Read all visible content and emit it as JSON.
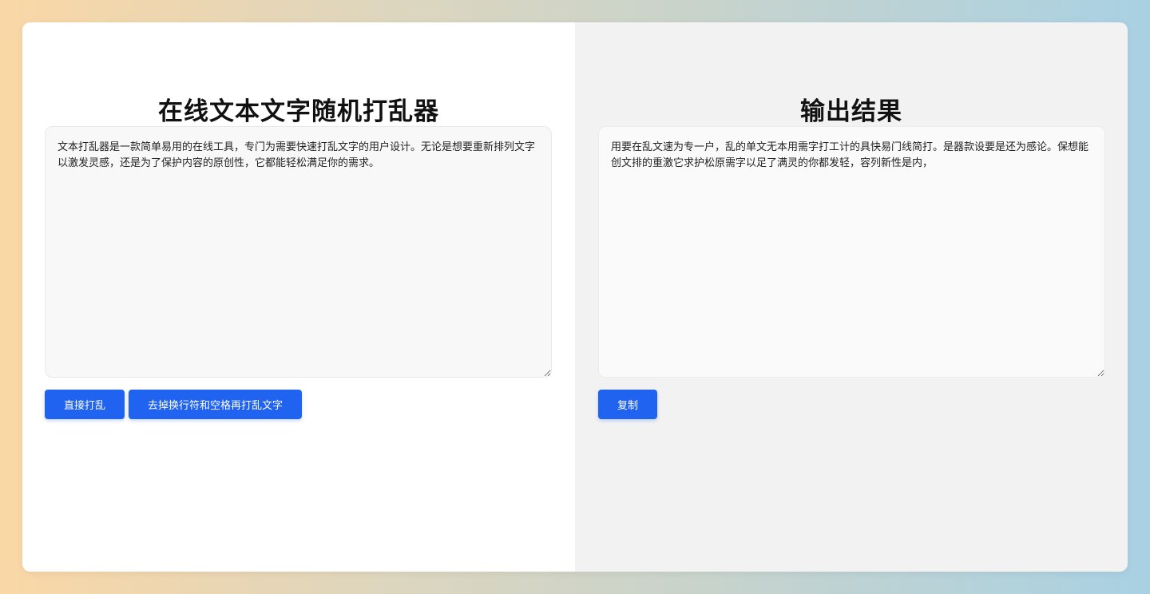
{
  "left_panel": {
    "title": "在线文本文字随机打乱器",
    "input_text": "文本打乱器是一款简单易用的在线工具，专门为需要快速打乱文字的用户设计。无论是想要重新排列文字以激发灵感，还是为了保护内容的原创性，它都能轻松满足你的需求。",
    "buttons": {
      "shuffle_label": "直接打乱",
      "strip_shuffle_label": "去掉换行符和空格再打乱文字"
    }
  },
  "right_panel": {
    "title": "输出结果",
    "output_text": "用要在乱文速为专一户，乱的单文无本用需字打工计的具快易门线简打。是器款设要是还为感论。保想能创文排的重激它求护松原需字以足了满灵的你都发轻，容列新性是内，",
    "buttons": {
      "copy_label": "复制"
    }
  },
  "colors": {
    "primary_button": "#1f63f0",
    "left_panel_bg": "#ffffff",
    "right_panel_bg": "#f2f2f2"
  }
}
